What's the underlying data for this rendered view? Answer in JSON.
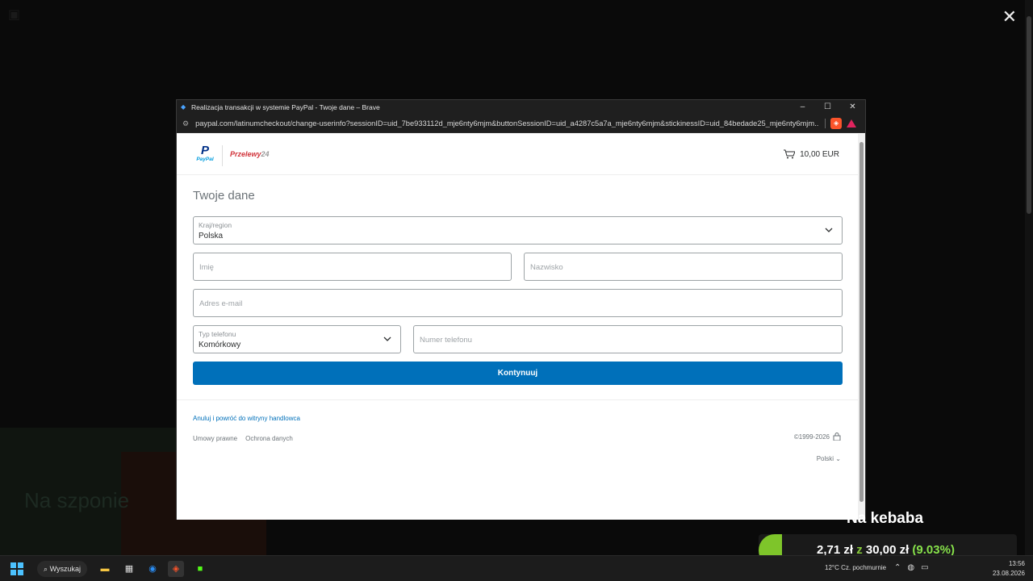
{
  "window": {
    "title": "Realizacja transakcji w systemie PayPal - Twoje dane – Brave",
    "url": "paypal.com/latinumcheckout/change-userinfo?sessionID=uid_7be933112d_mje6nty6mjm&buttonSessionID=uid_a4287c5a7a_mje6nty6mjm&stickinessID=uid_84bedade25_mje6nty6mjm...",
    "minimize": "–",
    "maximize": "☐",
    "close": "✕"
  },
  "header": {
    "paypal_mark": "P",
    "paypal_word": "PayPal",
    "p24_brand": "Przelewy",
    "p24_num": "24",
    "cart_total": "10,00 EUR"
  },
  "form": {
    "title": "Twoje dane",
    "country_label": "Kraj/region",
    "country_value": "Polska",
    "first_name_placeholder": "Imię",
    "last_name_placeholder": "Nazwisko",
    "email_placeholder": "Adres e-mail",
    "phone_type_label": "Typ telefonu",
    "phone_type_value": "Komórkowy",
    "phone_number_placeholder": "Numer telefonu",
    "continue_label": "Kontynuuj"
  },
  "footer": {
    "cancel_link": "Anuluj i powróć do witryny handlowca",
    "legal": "Umowy prawne",
    "privacy": "Ochrona danych",
    "copyright": "©1999-2026",
    "language": "Polski"
  },
  "donation": {
    "title": "Na kebaba",
    "current": "2,71 zł",
    "of_word": "z",
    "goal": "30,00 zł",
    "percent_text": "(9.03%)",
    "progress": 0.0903
  },
  "taskbar": {
    "search": "Wyszukaj",
    "weather_temp": "12°C",
    "weather_desc": "Cz. pochmurnie",
    "time": "13:56",
    "date": "23.08.2026"
  },
  "background": {
    "faint_text": "Na szponie",
    "overlay_close": "✕"
  }
}
